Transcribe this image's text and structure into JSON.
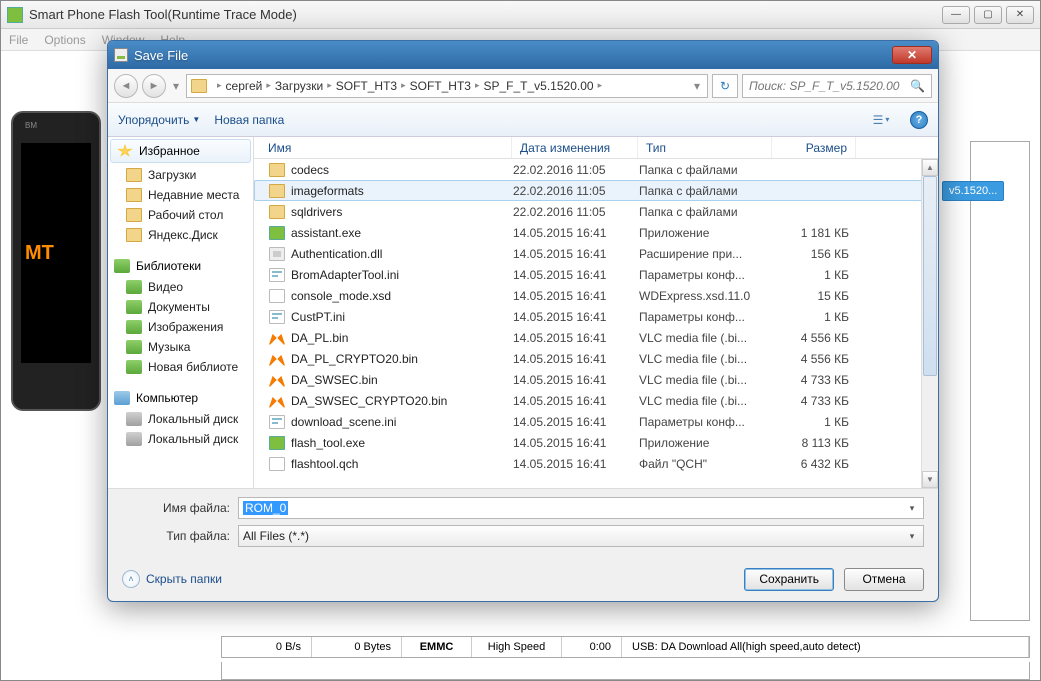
{
  "main": {
    "title": "Smart Phone Flash Tool(Runtime Trace Mode)",
    "menu": {
      "file": "File",
      "options": "Options",
      "window": "Window",
      "help": "Help"
    },
    "phone_brand": "BM",
    "phone_text": "MT",
    "right_chip": "v5.1520...",
    "status": {
      "bps": "0 B/s",
      "bytes": "0 Bytes",
      "storage": "EMMC",
      "speed": "High Speed",
      "time": "0:00",
      "usb": "USB: DA Download All(high speed,auto detect)"
    }
  },
  "dialog": {
    "title": "Save File",
    "path": [
      "сергей",
      "Загрузки",
      "SOFT_HT3",
      "SOFT_HT3",
      "SP_F_T_v5.1520.00"
    ],
    "search_placeholder": "Поиск: SP_F_T_v5.1520.00",
    "toolbar": {
      "organize": "Упорядочить",
      "new_folder": "Новая папка"
    },
    "sidebar": {
      "favorites": "Избранное",
      "fav_items": [
        "Загрузки",
        "Недавние места",
        "Рабочий стол",
        "Яндекс.Диск"
      ],
      "libraries": "Библиотеки",
      "lib_items": [
        "Видео",
        "Документы",
        "Изображения",
        "Музыка",
        "Новая библиоте"
      ],
      "computer": "Компьютер",
      "comp_items": [
        "Локальный диск",
        "Локальный диск"
      ]
    },
    "columns": {
      "name": "Имя",
      "date": "Дата изменения",
      "type": "Тип",
      "size": "Размер"
    },
    "files": [
      {
        "name": "codecs",
        "date": "22.02.2016 11:05",
        "type": "Папка с файлами",
        "size": "",
        "icon": "fi-folder",
        "sel": false
      },
      {
        "name": "imageformats",
        "date": "22.02.2016 11:05",
        "type": "Папка с файлами",
        "size": "",
        "icon": "fi-folder",
        "sel": true
      },
      {
        "name": "sqldrivers",
        "date": "22.02.2016 11:05",
        "type": "Папка с файлами",
        "size": "",
        "icon": "fi-folder",
        "sel": false
      },
      {
        "name": "assistant.exe",
        "date": "14.05.2015 16:41",
        "type": "Приложение",
        "size": "1 181 КБ",
        "icon": "fi-exe",
        "sel": false
      },
      {
        "name": "Authentication.dll",
        "date": "14.05.2015 16:41",
        "type": "Расширение при...",
        "size": "156 КБ",
        "icon": "fi-dll",
        "sel": false
      },
      {
        "name": "BromAdapterTool.ini",
        "date": "14.05.2015 16:41",
        "type": "Параметры конф...",
        "size": "1 КБ",
        "icon": "fi-ini",
        "sel": false
      },
      {
        "name": "console_mode.xsd",
        "date": "14.05.2015 16:41",
        "type": "WDExpress.xsd.11.0",
        "size": "15 КБ",
        "icon": "fi-xsd",
        "sel": false
      },
      {
        "name": "CustPT.ini",
        "date": "14.05.2015 16:41",
        "type": "Параметры конф...",
        "size": "1 КБ",
        "icon": "fi-ini",
        "sel": false
      },
      {
        "name": "DA_PL.bin",
        "date": "14.05.2015 16:41",
        "type": "VLC media file (.bi...",
        "size": "4 556 КБ",
        "icon": "fi-vlc",
        "sel": false
      },
      {
        "name": "DA_PL_CRYPTO20.bin",
        "date": "14.05.2015 16:41",
        "type": "VLC media file (.bi...",
        "size": "4 556 КБ",
        "icon": "fi-vlc",
        "sel": false
      },
      {
        "name": "DA_SWSEC.bin",
        "date": "14.05.2015 16:41",
        "type": "VLC media file (.bi...",
        "size": "4 733 КБ",
        "icon": "fi-vlc",
        "sel": false
      },
      {
        "name": "DA_SWSEC_CRYPTO20.bin",
        "date": "14.05.2015 16:41",
        "type": "VLC media file (.bi...",
        "size": "4 733 КБ",
        "icon": "fi-vlc",
        "sel": false
      },
      {
        "name": "download_scene.ini",
        "date": "14.05.2015 16:41",
        "type": "Параметры конф...",
        "size": "1 КБ",
        "icon": "fi-ini",
        "sel": false
      },
      {
        "name": "flash_tool.exe",
        "date": "14.05.2015 16:41",
        "type": "Приложение",
        "size": "8 113 КБ",
        "icon": "fi-exe",
        "sel": false
      },
      {
        "name": "flashtool.qch",
        "date": "14.05.2015 16:41",
        "type": "Файл \"QCH\"",
        "size": "6 432 КБ",
        "icon": "fi-file",
        "sel": false
      }
    ],
    "filename_label": "Имя файла:",
    "filename_value": "ROM_0",
    "filetype_label": "Тип файла:",
    "filetype_value": "All Files (*.*)",
    "hide_folders": "Скрыть папки",
    "save": "Сохранить",
    "cancel": "Отмена"
  }
}
